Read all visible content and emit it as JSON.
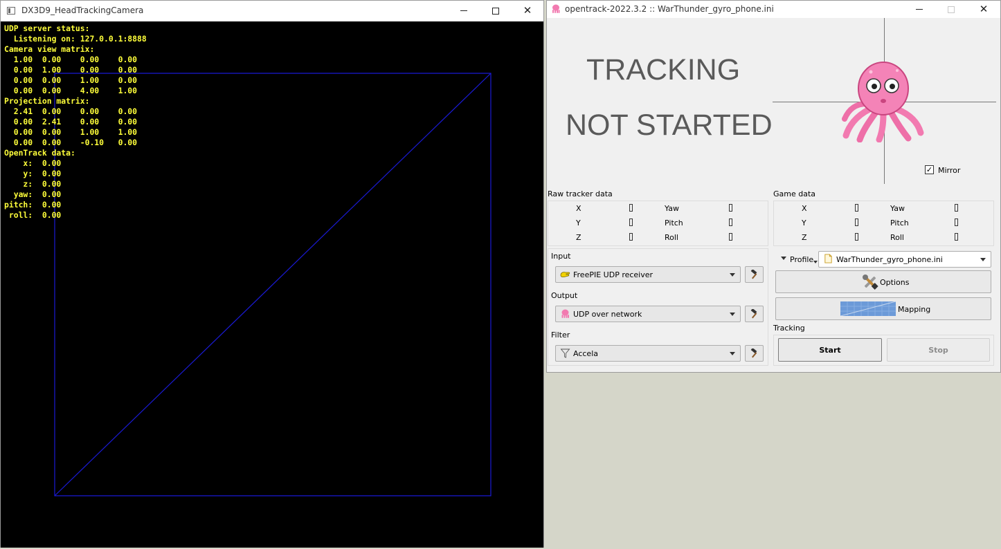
{
  "left_window": {
    "title": "DX3D9_HeadTrackingCamera",
    "overlay_lines": [
      "UDP server status:",
      "  Listening on: 127.0.0.1:8888",
      "Camera view matrix:",
      "  1.00  0.00    0.00    0.00",
      "  0.00  1.00    0.00    0.00",
      "  0.00  0.00    1.00    0.00",
      "  0.00  0.00    4.00    1.00",
      "Projection matrix:",
      "  2.41  0.00    0.00    0.00",
      "  0.00  2.41    0.00    0.00",
      "  0.00  0.00    1.00    1.00",
      "  0.00  0.00    -0.10   0.00",
      "OpenTrack data:",
      "    x:  0.00",
      "    y:  0.00",
      "    z:  0.00",
      "  yaw:  0.00",
      "pitch:  0.00",
      " roll:  0.00"
    ],
    "colors": {
      "background": "#000000",
      "text": "#ffff3a",
      "wireframe": "#1a1ad6"
    }
  },
  "right_window": {
    "title": "opentrack-2022.3.2 :: WarThunder_gyro_phone.ini",
    "status_line1": "TRACKING",
    "status_line2": "NOT STARTED",
    "mirror_label": "Mirror",
    "mirror_checked": true,
    "check_glyph": "✓",
    "raw_tracker": {
      "title": "Raw tracker data",
      "left_labels": [
        "X",
        "Y",
        "Z"
      ],
      "right_labels": [
        "Yaw",
        "Pitch",
        "Roll"
      ]
    },
    "game_data": {
      "title": "Game data",
      "left_labels": [
        "X",
        "Y",
        "Z"
      ],
      "right_labels": [
        "Yaw",
        "Pitch",
        "Roll"
      ]
    },
    "input": {
      "label": "Input",
      "value": "FreePIE UDP receiver",
      "icon": "hand-icon"
    },
    "output": {
      "label": "Output",
      "value": "UDP over network",
      "icon": "octopus-icon"
    },
    "filter": {
      "label": "Filter",
      "value": "Accela",
      "icon": "funnel-icon"
    },
    "profile": {
      "label": "Profile",
      "value": "WarThunder_gyro_phone.ini",
      "icon": "file-icon"
    },
    "options_label": "Options",
    "mapping_label": "Mapping",
    "tracking": {
      "label": "Tracking",
      "start_label": "Start",
      "stop_label": "Stop"
    },
    "colors": {
      "octopus": "#f27ab0",
      "panel": "#f0f0f0"
    }
  }
}
